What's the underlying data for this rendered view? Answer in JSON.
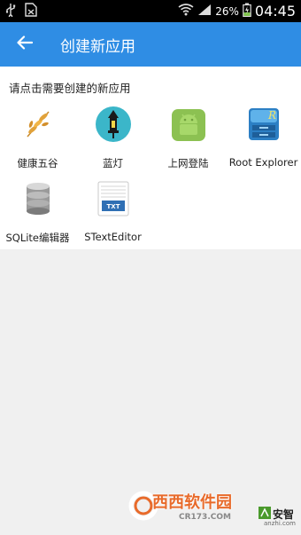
{
  "status_bar": {
    "battery": "26%",
    "time": "04:45"
  },
  "app_bar": {
    "title": "创建新应用",
    "accent": "#2f8de4"
  },
  "prompt": "请点击需要创建的新应用",
  "apps": [
    {
      "label": "健康五谷",
      "icon": "wheat-icon"
    },
    {
      "label": "蓝灯",
      "icon": "lantern-icon"
    },
    {
      "label": "上网登陆",
      "icon": "android-icon"
    },
    {
      "label": "Root Explorer",
      "icon": "root-explorer-icon"
    },
    {
      "label": "SQLite编辑器",
      "icon": "database-icon"
    },
    {
      "label": "STextEditor",
      "icon": "txt-file-icon"
    }
  ],
  "watermark": {
    "brand": "西西软件园",
    "domain": "CR173.COM",
    "partner": "安智",
    "partner_domain": "anzhi.com"
  }
}
